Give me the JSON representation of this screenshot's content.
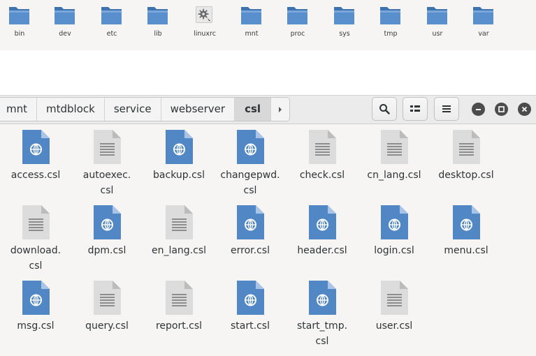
{
  "background_window": {
    "folders": [
      {
        "label": "bin",
        "icon": "folder-icon"
      },
      {
        "label": "dev",
        "icon": "folder-icon"
      },
      {
        "label": "etc",
        "icon": "folder-icon"
      },
      {
        "label": "lib",
        "icon": "folder-icon"
      },
      {
        "label": "linuxrc",
        "icon": "gear-icon"
      },
      {
        "label": "mnt",
        "icon": "folder-icon"
      },
      {
        "label": "proc",
        "icon": "folder-icon"
      },
      {
        "label": "sys",
        "icon": "folder-icon"
      },
      {
        "label": "tmp",
        "icon": "folder-icon"
      },
      {
        "label": "usr",
        "icon": "folder-icon"
      },
      {
        "label": "var",
        "icon": "folder-icon"
      }
    ]
  },
  "pathbar": {
    "crumbs": [
      "mnt",
      "mtdblock",
      "service",
      "webserver",
      "csl"
    ],
    "active": "csl"
  },
  "toolbar": {
    "search_icon": "search-icon",
    "view_icon": "list-view-icon",
    "menu_icon": "hamburger-menu-icon"
  },
  "window_controls": [
    "minimize-icon",
    "maximize-icon",
    "close-icon"
  ],
  "files": [
    {
      "name": "access.csl",
      "type": "web"
    },
    {
      "name": "autoexec.\ncsl",
      "type": "text"
    },
    {
      "name": "backup.csl",
      "type": "web"
    },
    {
      "name": "changepwd.\ncsl",
      "type": "web"
    },
    {
      "name": "check.csl",
      "type": "text"
    },
    {
      "name": "cn_lang.csl",
      "type": "text"
    },
    {
      "name": "desktop.csl",
      "type": "text"
    },
    {
      "name": "download.\ncsl",
      "type": "text"
    },
    {
      "name": "dpm.csl",
      "type": "web"
    },
    {
      "name": "en_lang.csl",
      "type": "text"
    },
    {
      "name": "error.csl",
      "type": "web"
    },
    {
      "name": "header.csl",
      "type": "web"
    },
    {
      "name": "login.csl",
      "type": "web"
    },
    {
      "name": "menu.csl",
      "type": "web"
    },
    {
      "name": "msg.csl",
      "type": "web"
    },
    {
      "name": "query.csl",
      "type": "text"
    },
    {
      "name": "report.csl",
      "type": "text"
    },
    {
      "name": "start.csl",
      "type": "web"
    },
    {
      "name": "start_tmp.\ncsl",
      "type": "web"
    },
    {
      "name": "user.csl",
      "type": "text"
    }
  ],
  "colors": {
    "folder_blue": "#4a86c8",
    "web_doc_blue": "#4a86c8",
    "text_doc_gray": "#d8d8d8",
    "header_bg": "#ebebeb",
    "content_bg": "#f6f5f4"
  }
}
